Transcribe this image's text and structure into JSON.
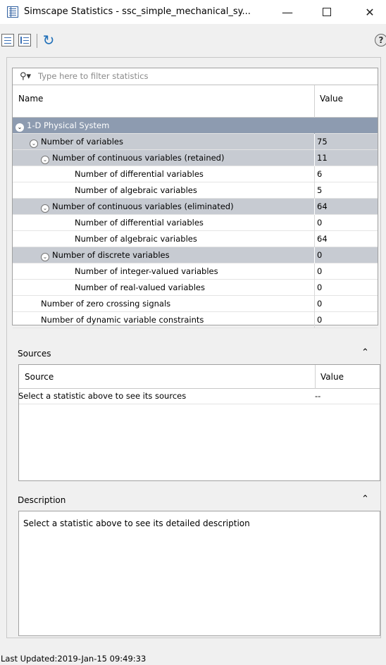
{
  "window": {
    "title": "Simscape Statistics - ssc_simple_mechanical_sy...",
    "min_glyph": "—",
    "close_glyph": "✕"
  },
  "toolbar": {
    "refresh_glyph": "↻",
    "help_glyph": "?"
  },
  "filter": {
    "icon_glyph": "⚲▾",
    "placeholder": "Type here to filter statistics"
  },
  "stats_table": {
    "headers": {
      "name": "Name",
      "value": "Value"
    },
    "rows": [
      {
        "name": "1-D Physical System",
        "value": "",
        "level": 0,
        "expanded": true
      },
      {
        "name": "Number of variables",
        "value": "75",
        "level": 1,
        "expanded": true
      },
      {
        "name": "Number of continuous variables (retained)",
        "value": "11",
        "level": 2,
        "expanded": true
      },
      {
        "name": "Number of differential variables",
        "value": "6",
        "level": 3
      },
      {
        "name": "Number of algebraic variables",
        "value": "5",
        "level": 3
      },
      {
        "name": "Number of continuous variables (eliminated)",
        "value": "64",
        "level": 2,
        "expanded": true
      },
      {
        "name": "Number of differential variables",
        "value": "0",
        "level": 3
      },
      {
        "name": "Number of algebraic variables",
        "value": "64",
        "level": 3
      },
      {
        "name": "Number of discrete variables",
        "value": "0",
        "level": 2,
        "expanded": true
      },
      {
        "name": "Number of integer-valued variables",
        "value": "0",
        "level": 3
      },
      {
        "name": "Number of real-valued variables",
        "value": "0",
        "level": 3
      },
      {
        "name": "Number of zero crossing signals",
        "value": "0",
        "level": 2
      },
      {
        "name": "Number of dynamic variable constraints",
        "value": "0",
        "level": 2
      }
    ]
  },
  "sources": {
    "title": "Sources",
    "collapse_glyph": "⌃",
    "headers": {
      "name": "Source",
      "value": "Value"
    },
    "row": {
      "name": "Select a statistic above to see its sources",
      "value": "--"
    }
  },
  "description": {
    "title": "Description",
    "collapse_glyph": "⌃",
    "text": "Select a statistic above to see its detailed description"
  },
  "status": {
    "text": "Last Updated:2019-Jan-15 09:49:33"
  }
}
